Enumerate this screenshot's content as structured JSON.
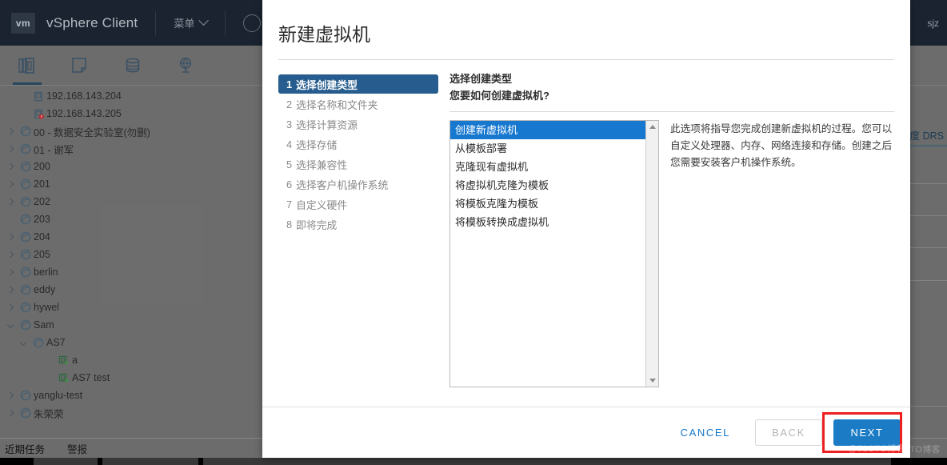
{
  "header": {
    "logo_text": "vm",
    "brand": "vSphere Client",
    "menu_label": "菜单",
    "user": "sjz"
  },
  "toolbar": {
    "items": [
      {
        "name": "hosts-and-clusters",
        "icon": "hosts-clusters-icon",
        "active": true
      },
      {
        "name": "vms-and-templates",
        "icon": "vm-templates-icon",
        "active": false
      },
      {
        "name": "storage",
        "icon": "storage-icon",
        "active": false
      },
      {
        "name": "networking",
        "icon": "networking-icon",
        "active": false
      }
    ]
  },
  "tree": {
    "items": [
      {
        "label": "192.168.143.204",
        "indent": 1,
        "arrow": "none",
        "icon": "host-icon"
      },
      {
        "label": "192.168.143.205",
        "indent": 1,
        "arrow": "none",
        "icon": "host-alert-icon"
      },
      {
        "label": "00 - 数据安全实验室(勿删)",
        "indent": 0,
        "arrow": "right",
        "icon": "resource-pool-icon"
      },
      {
        "label": "01 - 谢军",
        "indent": 0,
        "arrow": "right",
        "icon": "resource-pool-icon"
      },
      {
        "label": "200",
        "indent": 0,
        "arrow": "right",
        "icon": "resource-pool-icon"
      },
      {
        "label": "201",
        "indent": 0,
        "arrow": "right",
        "icon": "resource-pool-icon"
      },
      {
        "label": "202",
        "indent": 0,
        "arrow": "right",
        "icon": "resource-pool-icon"
      },
      {
        "label": "203",
        "indent": 0,
        "arrow": "none",
        "icon": "resource-pool-icon"
      },
      {
        "label": "204",
        "indent": 0,
        "arrow": "right",
        "icon": "resource-pool-icon"
      },
      {
        "label": "205",
        "indent": 0,
        "arrow": "right",
        "icon": "resource-pool-icon"
      },
      {
        "label": "berlin",
        "indent": 0,
        "arrow": "right",
        "icon": "resource-pool-icon"
      },
      {
        "label": "eddy",
        "indent": 0,
        "arrow": "right",
        "icon": "resource-pool-icon"
      },
      {
        "label": "hywel",
        "indent": 0,
        "arrow": "right",
        "icon": "resource-pool-icon"
      },
      {
        "label": "Sam",
        "indent": 0,
        "arrow": "down",
        "icon": "resource-pool-icon"
      },
      {
        "label": "AS7",
        "indent": 1,
        "arrow": "down",
        "icon": "resource-pool-icon"
      },
      {
        "label": "a",
        "indent": 3,
        "arrow": "none",
        "icon": "vm-powered-on-icon"
      },
      {
        "label": "AS7 test",
        "indent": 3,
        "arrow": "none",
        "icon": "vm-powered-on-icon"
      },
      {
        "label": "yanglu-test",
        "indent": 0,
        "arrow": "right",
        "icon": "resource-pool-icon"
      },
      {
        "label": "朱荣荣",
        "indent": 0,
        "arrow": "right",
        "icon": "resource-pool-icon"
      }
    ]
  },
  "background_panel": {
    "column_header_fragment": "度 DRS"
  },
  "bottom_bar": {
    "recent_tasks": "近期任务",
    "alarms": "警报"
  },
  "dialog": {
    "title": "新建虚拟机",
    "steps": [
      {
        "num": "1",
        "label": "选择创建类型",
        "active": true
      },
      {
        "num": "2",
        "label": "选择名称和文件夹",
        "active": false
      },
      {
        "num": "3",
        "label": "选择计算资源",
        "active": false
      },
      {
        "num": "4",
        "label": "选择存储",
        "active": false
      },
      {
        "num": "5",
        "label": "选择兼容性",
        "active": false
      },
      {
        "num": "6",
        "label": "选择客户机操作系统",
        "active": false
      },
      {
        "num": "7",
        "label": "自定义硬件",
        "active": false
      },
      {
        "num": "8",
        "label": "即将完成",
        "active": false
      }
    ],
    "pane_heading": "选择创建类型",
    "pane_subheading": "您要如何创建虚拟机?",
    "options": [
      {
        "label": "创建新虚拟机",
        "selected": true
      },
      {
        "label": "从模板部署",
        "selected": false
      },
      {
        "label": "克隆现有虚拟机",
        "selected": false
      },
      {
        "label": "将虚拟机克隆为模板",
        "selected": false
      },
      {
        "label": "将模板克隆为模板",
        "selected": false
      },
      {
        "label": "将模板转换成虚拟机",
        "selected": false
      }
    ],
    "description": "此选项将指导您完成创建新虚拟机的过程。您可以自定义处理器、内存、网络连接和存储。创建之后您需要安装客户机操作系统。",
    "buttons": {
      "cancel": "CANCEL",
      "back": "BACK",
      "next": "NEXT"
    },
    "colors": {
      "primary": "#1b7bc4",
      "step_active": "#265d8e",
      "option_selected": "#1778d0",
      "highlight_box": "#ef1f1f"
    }
  },
  "watermark": {
    "text": "@51CTO博客"
  }
}
